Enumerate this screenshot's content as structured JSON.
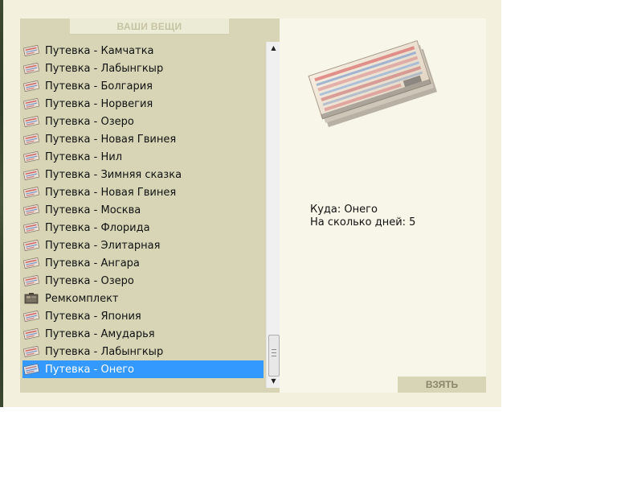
{
  "header": {
    "title": "ВАШИ ВЕЩИ"
  },
  "items": [
    {
      "label": "Путевка - Камчатка",
      "icon": "ticket-icon",
      "selected": false
    },
    {
      "label": "Путевка - Лабынгкыр",
      "icon": "ticket-icon",
      "selected": false
    },
    {
      "label": "Путевка - Болгария",
      "icon": "ticket-icon",
      "selected": false
    },
    {
      "label": "Путевка - Норвегия",
      "icon": "ticket-icon",
      "selected": false
    },
    {
      "label": "Путевка - Озеро",
      "icon": "ticket-icon",
      "selected": false
    },
    {
      "label": "Путевка - Новая Гвинея",
      "icon": "ticket-icon",
      "selected": false
    },
    {
      "label": "Путевка - Нил",
      "icon": "ticket-icon",
      "selected": false
    },
    {
      "label": "Путевка - Зимняя сказка",
      "icon": "ticket-icon",
      "selected": false
    },
    {
      "label": "Путевка - Новая Гвинея",
      "icon": "ticket-icon",
      "selected": false
    },
    {
      "label": "Путевка - Москва",
      "icon": "ticket-icon",
      "selected": false
    },
    {
      "label": "Путевка - Флорида",
      "icon": "ticket-icon",
      "selected": false
    },
    {
      "label": "Путевка - Элитарная",
      "icon": "ticket-icon",
      "selected": false
    },
    {
      "label": "Путевка - Ангара",
      "icon": "ticket-icon",
      "selected": false
    },
    {
      "label": "Путевка - Озеро",
      "icon": "ticket-icon",
      "selected": false
    },
    {
      "label": "Ремкомплект",
      "icon": "repair-kit-icon",
      "selected": false
    },
    {
      "label": "Путевка - Япония",
      "icon": "ticket-icon",
      "selected": false
    },
    {
      "label": "Путевка - Амударья",
      "icon": "ticket-icon",
      "selected": false
    },
    {
      "label": "Путевка - Лабынгкыр",
      "icon": "ticket-icon",
      "selected": false
    },
    {
      "label": "Путевка - Онего",
      "icon": "ticket-icon",
      "selected": true
    }
  ],
  "details": {
    "image": "ticket-bundle-image",
    "destination": "Куда: Онего",
    "days": "На сколько дней: 5"
  },
  "actions": {
    "take_label": "ВЗЯТЬ"
  },
  "colors": {
    "selected_bg": "#3399ff",
    "panel_bg": "#d7d5b6",
    "frame_bg": "#f3f1de"
  }
}
